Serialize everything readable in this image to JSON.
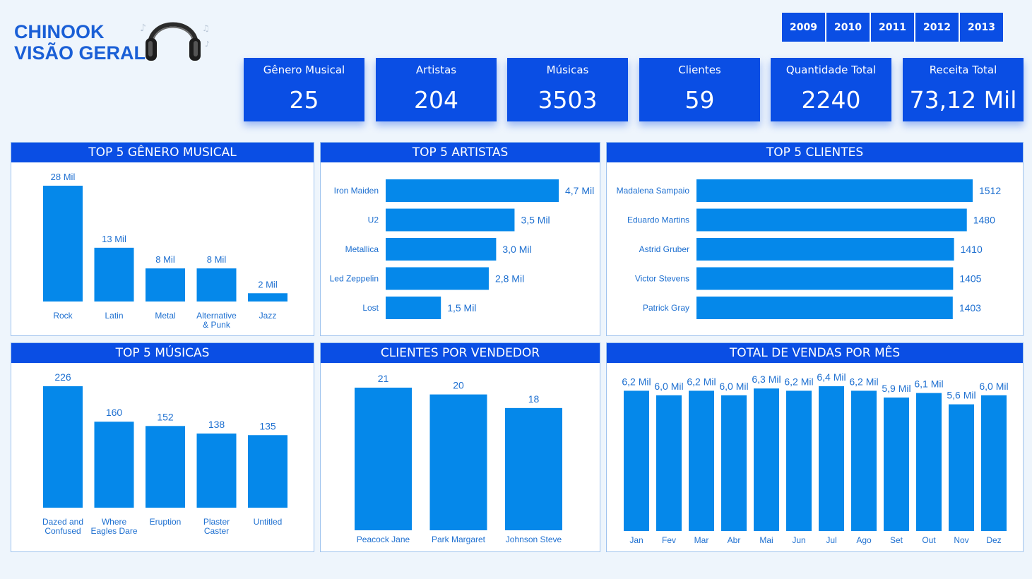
{
  "brand": {
    "line1": "CHINOOK",
    "line2": "VISÃO GERAL"
  },
  "icons": {
    "logo": "headphones-icon"
  },
  "colors": {
    "accent": "#0a4ee4",
    "bar": "#0588ea",
    "label": "#1d6fd0",
    "background": "#eef5fc"
  },
  "years": [
    "2009",
    "2010",
    "2011",
    "2012",
    "2013"
  ],
  "kpis": [
    {
      "label": "Gênero Musical",
      "value": "25"
    },
    {
      "label": "Artistas",
      "value": "204"
    },
    {
      "label": "Músicas",
      "value": "3503"
    },
    {
      "label": "Clientes",
      "value": "59"
    },
    {
      "label": "Quantidade Total",
      "value": "2240"
    },
    {
      "label": "Receita Total",
      "value": "73,12 Mil"
    }
  ],
  "chart_data": [
    {
      "id": "genres",
      "type": "bar",
      "title": "TOP 5 GÊNERO MUSICAL",
      "categories": [
        "Rock",
        "Latin",
        "Metal",
        "Alternative & Punk",
        "Jazz"
      ],
      "values": [
        28000,
        13000,
        8000,
        8000,
        2000
      ],
      "data_labels": [
        "28 Mil",
        "13 Mil",
        "8 Mil",
        "8 Mil",
        "2 Mil"
      ],
      "ylim": [
        0,
        28000
      ]
    },
    {
      "id": "artists",
      "type": "bar",
      "orientation": "horizontal",
      "title": "TOP 5 ARTISTAS",
      "categories": [
        "Iron Maiden",
        "U2",
        "Metallica",
        "Led Zeppelin",
        "Lost"
      ],
      "values": [
        4700,
        3500,
        3000,
        2800,
        1500
      ],
      "data_labels": [
        "4,7 Mil",
        "3,5 Mil",
        "3,0 Mil",
        "2,8 Mil",
        "1,5 Mil"
      ],
      "xlim": [
        0,
        4700
      ]
    },
    {
      "id": "customers",
      "type": "bar",
      "orientation": "horizontal",
      "title": "TOP 5 CLIENTES",
      "categories": [
        "Madalena Sampaio",
        "Eduardo Martins",
        "Astrid Gruber",
        "Victor Stevens",
        "Patrick Gray"
      ],
      "values": [
        1512,
        1480,
        1410,
        1405,
        1403
      ],
      "data_labels": [
        "1512",
        "1480",
        "1410",
        "1405",
        "1403"
      ],
      "xlim": [
        0,
        1512
      ]
    },
    {
      "id": "songs",
      "type": "bar",
      "title": "TOP 5 MÚSICAS",
      "categories": [
        "Dazed and Confused",
        "Where Eagles Dare",
        "Eruption",
        "Plaster Caster",
        "Untitled"
      ],
      "values": [
        226,
        160,
        152,
        138,
        135
      ],
      "data_labels": [
        "226",
        "160",
        "152",
        "138",
        "135"
      ],
      "ylim": [
        0,
        226
      ]
    },
    {
      "id": "sellers",
      "type": "bar",
      "title": "CLIENTES POR VENDEDOR",
      "categories": [
        "Peacock Jane",
        "Park Margaret",
        "Johnson Steve"
      ],
      "values": [
        21,
        20,
        18
      ],
      "data_labels": [
        "21",
        "20",
        "18"
      ],
      "ylim": [
        0,
        21
      ]
    },
    {
      "id": "months",
      "type": "bar",
      "title": "TOTAL DE VENDAS POR MÊS",
      "categories": [
        "Jan",
        "Fev",
        "Mar",
        "Abr",
        "Mai",
        "Jun",
        "Jul",
        "Ago",
        "Set",
        "Out",
        "Nov",
        "Dez"
      ],
      "values": [
        6200,
        6000,
        6200,
        6000,
        6300,
        6200,
        6400,
        6200,
        5900,
        6100,
        5600,
        6000
      ],
      "data_labels": [
        "6,2 Mil",
        "6,0 Mil",
        "6,2 Mil",
        "6,0 Mil",
        "6,3 Mil",
        "6,2 Mil",
        "6,4 Mil",
        "6,2 Mil",
        "5,9 Mil",
        "6,1 Mil",
        "5,6 Mil",
        "6,0 Mil"
      ],
      "ylim": [
        0,
        6400
      ]
    }
  ]
}
